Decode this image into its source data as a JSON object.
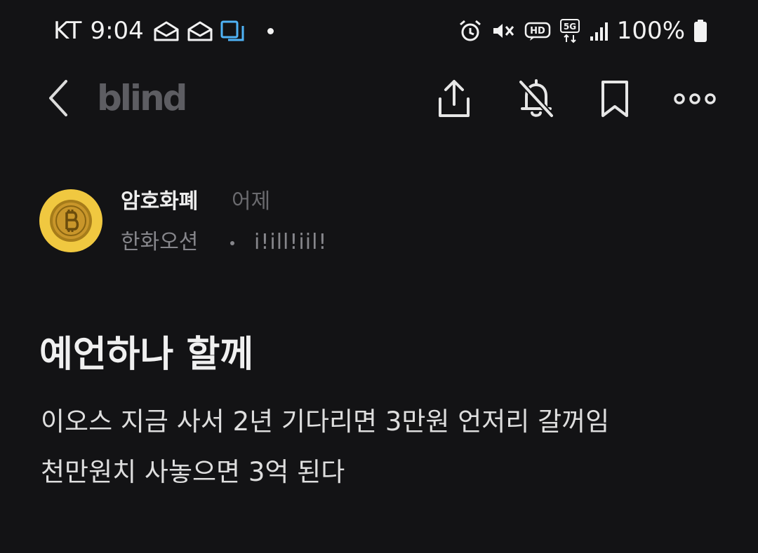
{
  "status_bar": {
    "carrier": "KT",
    "time": "9:04",
    "battery": "100%",
    "icons": [
      "mail-icon",
      "mail-icon",
      "screen-cast-icon",
      "alarm-icon",
      "vibrate-mute-icon",
      "hd-voice-icon",
      "5g-icon",
      "signal-icon",
      "battery-icon"
    ]
  },
  "app_bar": {
    "brand": "blind",
    "actions": [
      "back-icon",
      "share-icon",
      "notifications-off-icon",
      "bookmark-icon",
      "more-icon"
    ]
  },
  "author": {
    "name": "암호화폐",
    "time": "어제",
    "company": "한화오션",
    "handle": "i!ill!iil!",
    "avatar_color": "#f0c840"
  },
  "post": {
    "title": "예언하나 할께",
    "body_lines": [
      "이오스 지금 사서 2년 기다리면 3만원 언저리 갈꺼임",
      "천만원치 사놓으면 3억 된다"
    ]
  },
  "colors": {
    "background": "#131315",
    "text": "#f0f0f0",
    "muted": "#86868b",
    "brand": "#5d5d62"
  }
}
